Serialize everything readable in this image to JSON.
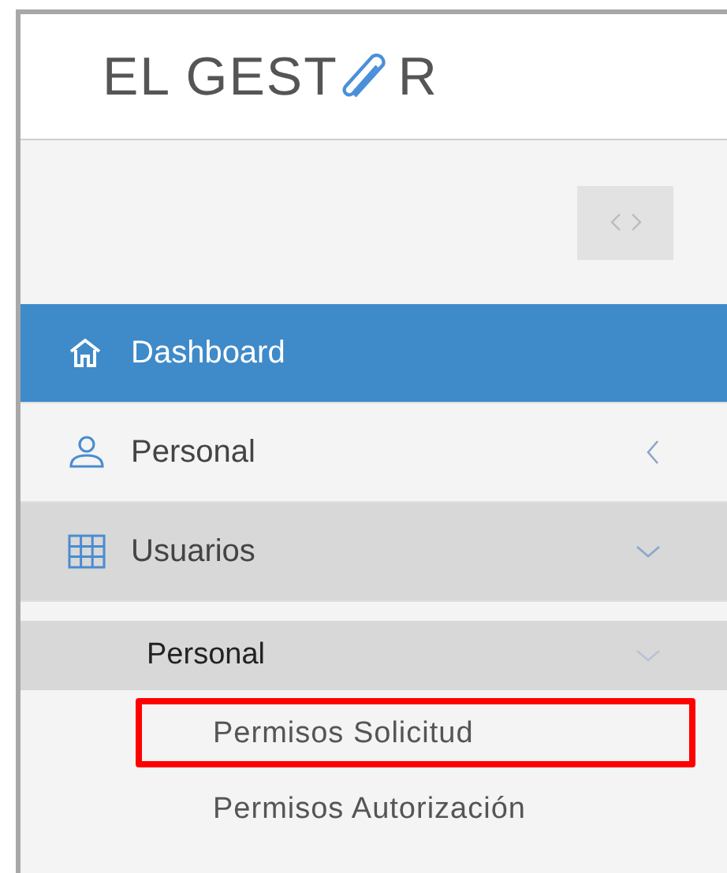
{
  "logo": {
    "text_before_clip": "EL GEST",
    "text_after_clip": "R"
  },
  "menu": [
    {
      "label": "Dashboard",
      "selected": true
    },
    {
      "label": "Personal",
      "selected": false,
      "expanded": false
    },
    {
      "label": "Usuarios",
      "selected": false,
      "expanded": true,
      "children": [
        {
          "label": "Personal",
          "expanded": true,
          "children": [
            {
              "label": "Permisos Solicitud",
              "highlighted": true
            },
            {
              "label": "Permisos Autorización",
              "highlighted": false
            }
          ]
        }
      ]
    }
  ]
}
